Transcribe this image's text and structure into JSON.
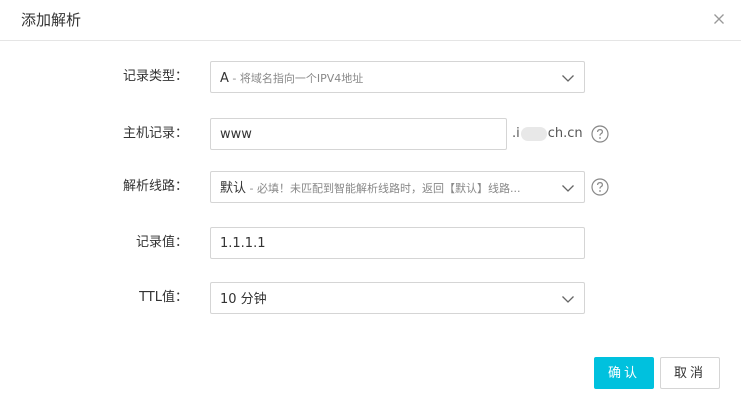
{
  "dialog": {
    "title": "添加解析",
    "close_icon": "close-icon"
  },
  "form": {
    "record_type": {
      "label": "记录类型：",
      "value_main": "A",
      "value_desc": " - 将域名指向一个IPV4地址"
    },
    "host_record": {
      "label": "主机记录：",
      "value": "www",
      "suffix_start": ".i",
      "suffix_end": "ch.cn"
    },
    "line": {
      "label": "解析线路：",
      "value_main": "默认",
      "value_desc": " - 必填！未匹配到智能解析线路时，返回【默认】线路..."
    },
    "record_value": {
      "label": "记录值：",
      "value": "1.1.1.1"
    },
    "ttl": {
      "label": "TTL值：",
      "value": "10 分钟"
    }
  },
  "buttons": {
    "ok": "确认",
    "cancel": "取消"
  },
  "colors": {
    "primary": "#00c1de",
    "border": "#d5d5d5"
  }
}
